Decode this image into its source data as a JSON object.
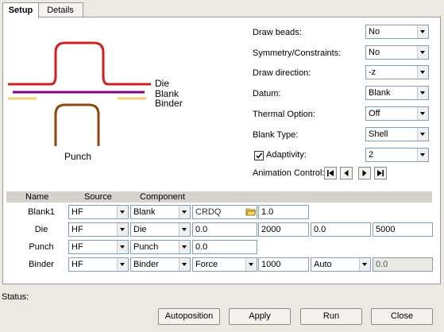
{
  "tabs": [
    {
      "label": "Setup"
    },
    {
      "label": "Details"
    }
  ],
  "diagram": {
    "die_label": "Die",
    "blank_label": "Blank",
    "binder_label": "Binder",
    "punch_label": "Punch",
    "colors": {
      "die": "#d02020",
      "blank": "#800080",
      "binder": "#f0d070",
      "punch": "#8b4a14"
    }
  },
  "options": [
    {
      "label": "Draw beads:",
      "value": "No"
    },
    {
      "label": "Symmetry/Constraints:",
      "value": "No"
    },
    {
      "label": "Draw direction:",
      "value": "-z"
    },
    {
      "label": "Datum:",
      "value": "Blank"
    },
    {
      "label": "Thermal Option:",
      "value": "Off"
    },
    {
      "label": "Blank Type:",
      "value": "Shell"
    }
  ],
  "adaptivity": {
    "label": "Adaptivity:",
    "checked": true,
    "value": "2"
  },
  "animation": {
    "label": "Animation Control:",
    "buttons": [
      "first-frame-icon",
      "previous-frame-icon",
      "next-frame-icon",
      "last-frame-icon"
    ]
  },
  "table": {
    "headers": {
      "name": "Name",
      "source": "Source",
      "component": "Component"
    },
    "rows": [
      {
        "name": "Blank1",
        "source": "HF",
        "component": "Blank",
        "material": "CRDQ",
        "thickness": "1.0"
      },
      {
        "name": "Die",
        "source": "HF",
        "component": "Die",
        "v1": "0.0",
        "v2": "2000",
        "v3": "0.0",
        "v4": "5000"
      },
      {
        "name": "Punch",
        "source": "HF",
        "component": "Punch",
        "v1": "0.0"
      },
      {
        "name": "Binder",
        "source": "HF",
        "component": "Binder",
        "control": "Force",
        "force": "1000",
        "mode": "Auto",
        "v4": "0.0"
      }
    ]
  },
  "status": {
    "label": "Status:"
  },
  "buttons": {
    "autoposition": "Autoposition",
    "apply": "Apply",
    "run": "Run",
    "close": "Close"
  }
}
